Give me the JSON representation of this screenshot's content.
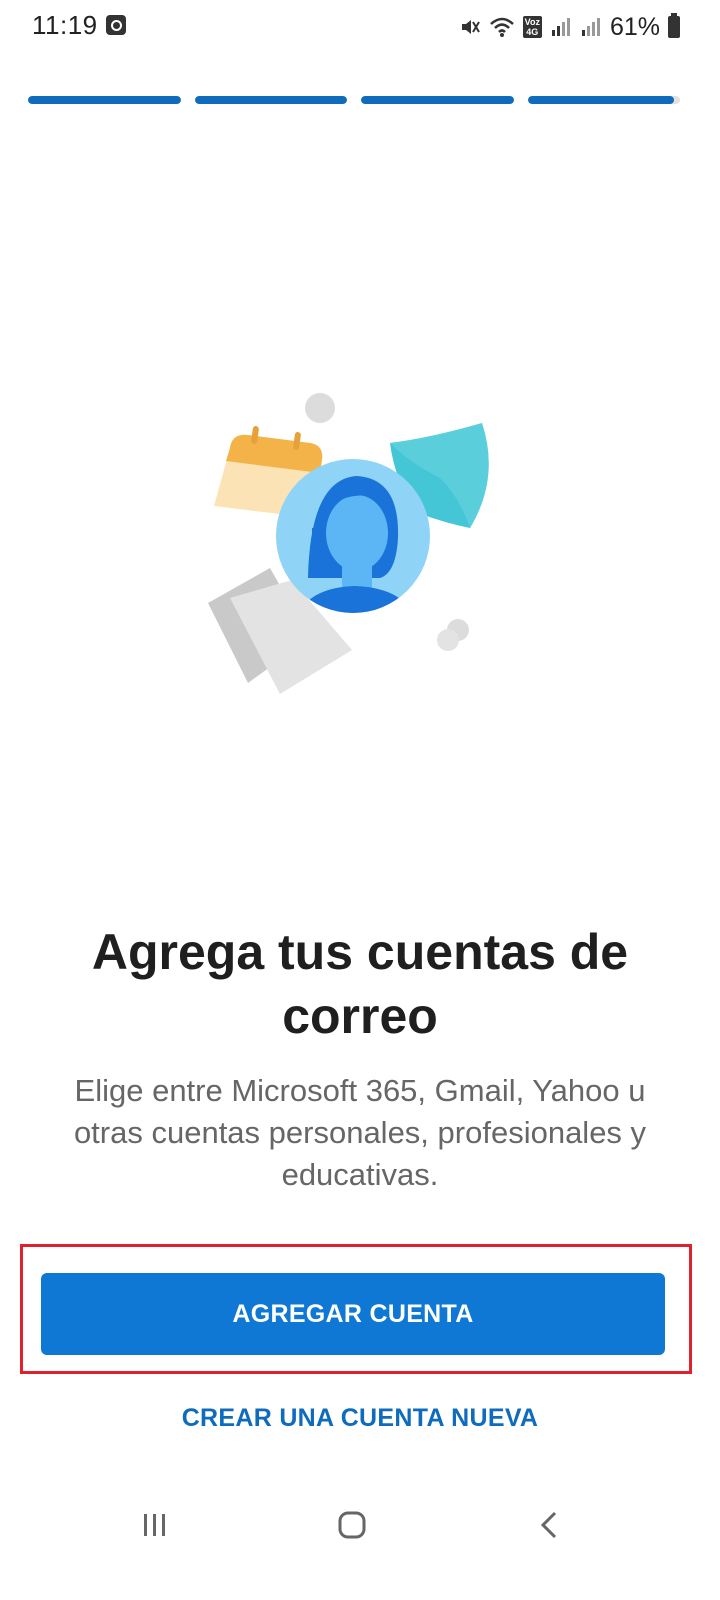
{
  "status_bar": {
    "time": "11:19",
    "battery_text": "61%",
    "network_badge_top": "Voz",
    "network_badge_bottom": "4G"
  },
  "onboarding": {
    "progress_segments": [
      1.0,
      1.0,
      1.0,
      0.96
    ],
    "headline": "Agrega tus cuentas de correo",
    "description": "Elige entre Microsoft 365, Gmail, Yahoo u otras cuentas personales, profesionales y educativas.",
    "primary_button_label": "AGREGAR CUENTA",
    "secondary_link_label": "CREAR UNA CUENTA NUEVA"
  },
  "colors": {
    "accent": "#0f78d4",
    "progress": "#0f6cbd",
    "highlight_border": "#e0202a",
    "headline": "#1f1f1f",
    "body_text": "#666666"
  },
  "icons": {
    "status": [
      "app-notification-icon",
      "mute-icon",
      "wifi-icon",
      "signal-icon",
      "battery-icon"
    ],
    "illustration": [
      "calendar-icon",
      "shield-icon",
      "avatar-icon",
      "document-icon"
    ],
    "navigation": [
      "recents-icon",
      "home-icon",
      "back-icon"
    ]
  }
}
